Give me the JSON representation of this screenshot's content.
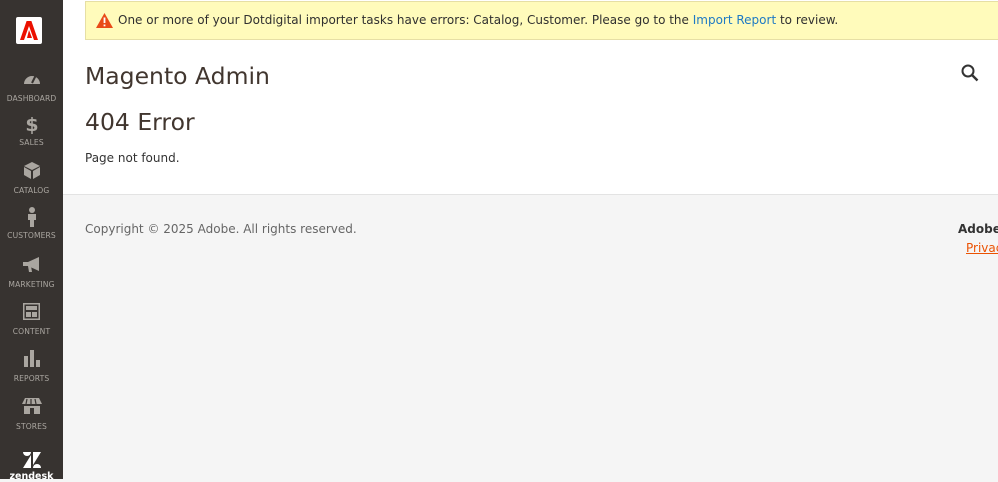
{
  "sidebar": {
    "logo": "adobe-logo",
    "items": [
      {
        "label": "DASHBOARD",
        "icon": "speedometer-icon"
      },
      {
        "label": "SALES",
        "icon": "dollar-icon"
      },
      {
        "label": "CATALOG",
        "icon": "box-icon"
      },
      {
        "label": "CUSTOMERS",
        "icon": "person-icon"
      },
      {
        "label": "MARKETING",
        "icon": "megaphone-icon"
      },
      {
        "label": "CONTENT",
        "icon": "layout-icon"
      },
      {
        "label": "REPORTS",
        "icon": "bar-chart-icon"
      },
      {
        "label": "STORES",
        "icon": "storefront-icon"
      }
    ],
    "zendesk_label": "zendesk"
  },
  "notice": {
    "text_before": "One or more of your Dotdigital importer tasks have errors: Catalog, Customer. Please go to the ",
    "link_text": "Import Report",
    "text_after": " to review."
  },
  "header": {
    "title": "Magento Admin"
  },
  "error": {
    "title": "404 Error",
    "message": "Page not found."
  },
  "footer": {
    "copyright": "Copyright © 2025 Adobe. All rights reserved.",
    "brand": "Adobe C",
    "privacy_link": "Privacy"
  },
  "colors": {
    "sidebar_bg": "#373330",
    "notice_bg": "#fffbbb",
    "link": "#1e7ac4",
    "footer_link": "#eb5202",
    "warning": "#e22626"
  }
}
